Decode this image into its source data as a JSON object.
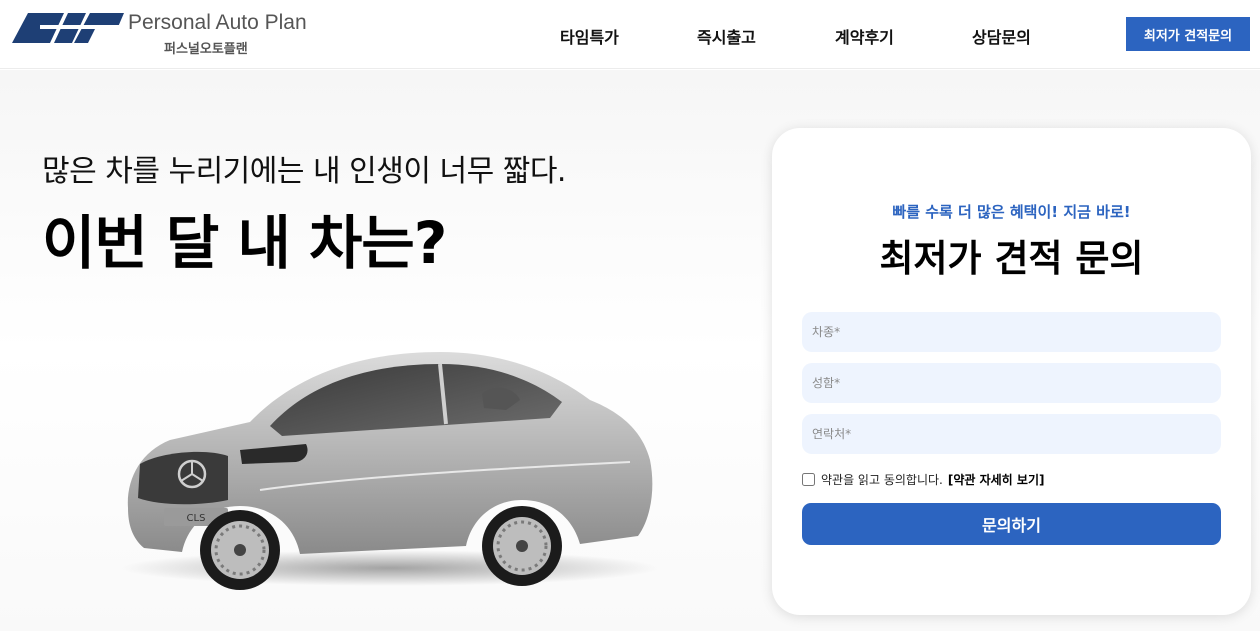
{
  "brand": {
    "name_en": "Personal Auto Plan",
    "name_ko": "퍼스널오토플랜",
    "logo_icon": "pap-logo-icon",
    "brand_color": "#2c64c0",
    "logo_color": "#1e3f75"
  },
  "nav": {
    "items": [
      {
        "label": "타임특가"
      },
      {
        "label": "즉시출고"
      },
      {
        "label": "계약후기"
      },
      {
        "label": "상담문의"
      }
    ],
    "cta_label": "최저가 견적문의"
  },
  "hero": {
    "subtitle": "많은 차를 누리기에는 내 인생이 너무 짧다.",
    "title": "이번 달 내 차는?",
    "car_badge": "CLS",
    "car_color": "silver"
  },
  "form": {
    "eyebrow": "빠를 수록 더 많은 혜택이! 지금 바로!",
    "title": "최저가 견적 문의",
    "fields": [
      {
        "placeholder": "차종*",
        "value": ""
      },
      {
        "placeholder": "성함*",
        "value": ""
      },
      {
        "placeholder": "연락처*",
        "value": ""
      }
    ],
    "agree_text": "약관을 읽고 동의합니다.",
    "agree_link": "[약관 자세히 보기]",
    "agree_checked": false,
    "submit_label": "문의하기",
    "field_bg": "#eef4fe"
  }
}
